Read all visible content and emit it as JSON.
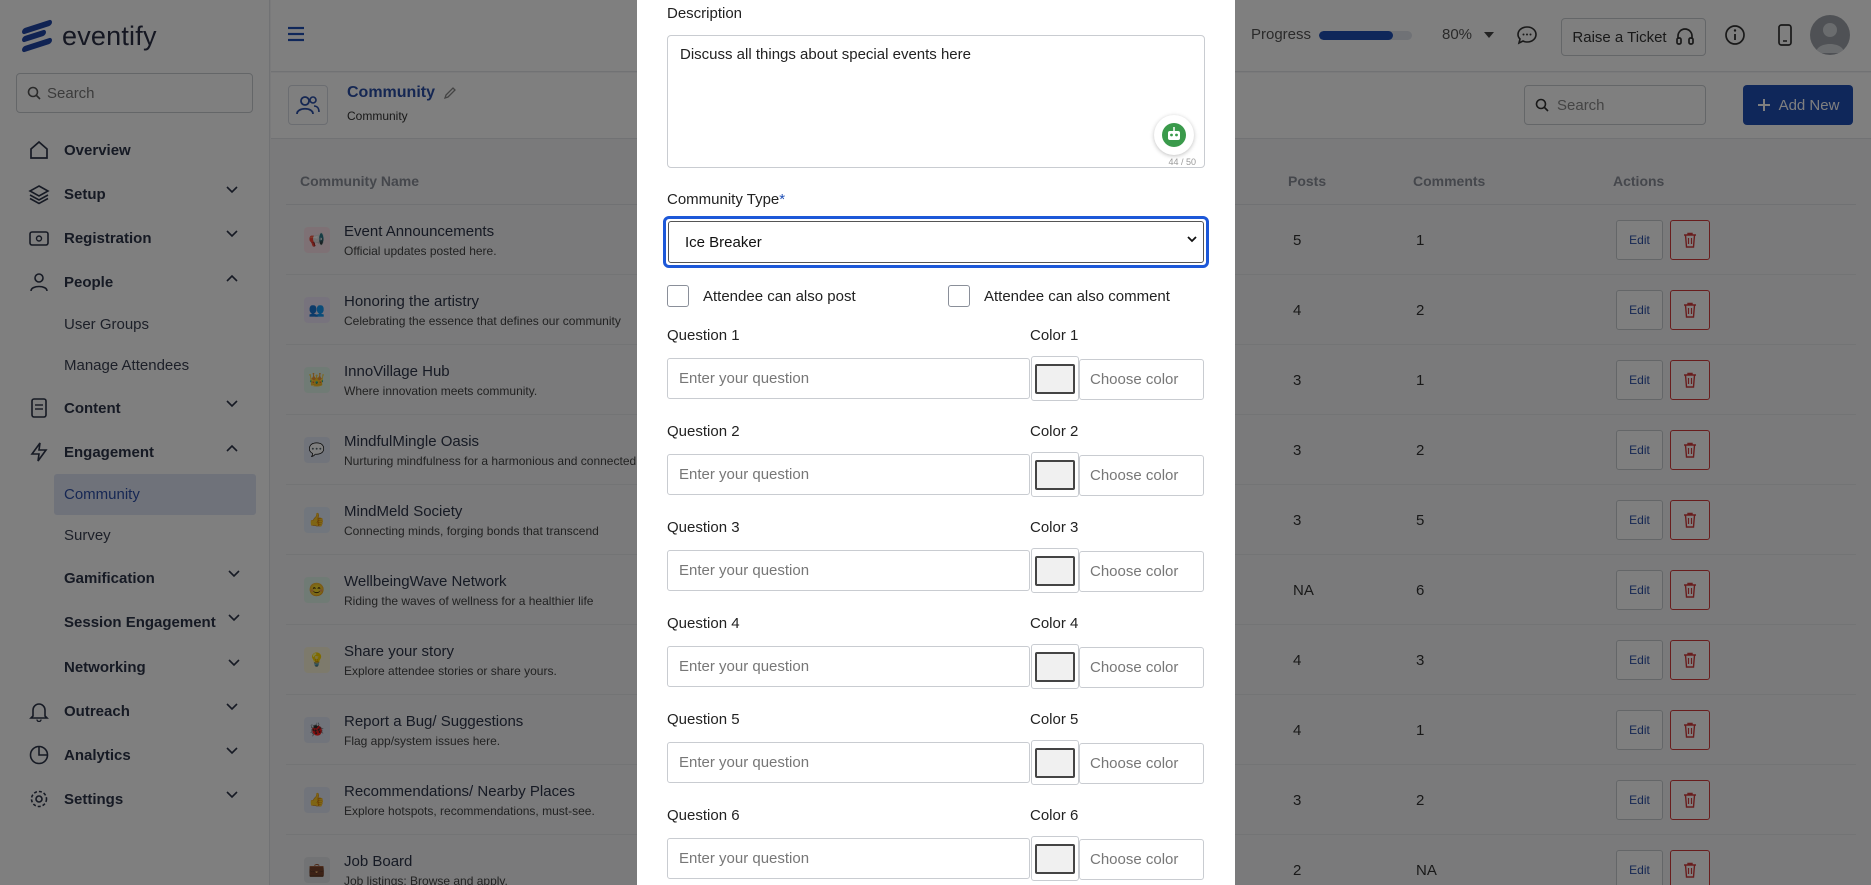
{
  "app": {
    "name": "eventify"
  },
  "sidebar": {
    "search_placeholder": "Search",
    "items": [
      {
        "label": "Overview"
      },
      {
        "label": "Setup"
      },
      {
        "label": "Registration"
      },
      {
        "label": "People"
      },
      {
        "label": "User Groups"
      },
      {
        "label": "Manage Attendees"
      },
      {
        "label": "Content"
      },
      {
        "label": "Engagement"
      },
      {
        "label": "Community"
      },
      {
        "label": "Survey"
      },
      {
        "label": "Gamification"
      },
      {
        "label": "Session Engagement"
      },
      {
        "label": "Networking"
      },
      {
        "label": "Outreach"
      },
      {
        "label": "Analytics"
      },
      {
        "label": "Settings"
      }
    ]
  },
  "topbar": {
    "progress_label": "Progress",
    "progress_value": 0.8,
    "progress_pct": "80%",
    "ticket_label": "Raise a Ticket"
  },
  "page": {
    "title": "Community",
    "subtitle": "Community",
    "search_placeholder": "Search",
    "add_label": "Add New"
  },
  "table": {
    "headers": {
      "name": "Community Name",
      "posts": "Posts",
      "comments": "Comments",
      "actions": "Actions"
    },
    "edit_label": "Edit",
    "rows": [
      {
        "name": "Event Announcements",
        "desc": "Official updates posted here.",
        "posts": "5",
        "comments": "1",
        "icon_color": "#e0245e",
        "icon_bg": "#fde3ea",
        "icon": "📢"
      },
      {
        "name": "Honoring the artistry",
        "desc": "Celebrating the essence that defines our community",
        "posts": "4",
        "comments": "2",
        "icon_color": "#8a4fd3",
        "icon_bg": "#efe6fb",
        "icon": "👥"
      },
      {
        "name": "InnoVillage Hub",
        "desc": "Where innovation meets community.",
        "posts": "3",
        "comments": "1",
        "icon_color": "#18a058",
        "icon_bg": "#e1f6ea",
        "icon": "👑"
      },
      {
        "name": "MindfulMingle Oasis",
        "desc": "Nurturing mindfulness for a harmonious and connected",
        "posts": "3",
        "comments": "2",
        "icon_color": "#2a4ea6",
        "icon_bg": "#e2e8f7",
        "icon": "💬"
      },
      {
        "name": "MindMeld Society",
        "desc": "Connecting minds, forging bonds that transcend",
        "posts": "3",
        "comments": "5",
        "icon_color": "#2a6fd6",
        "icon_bg": "#e2ecfb",
        "icon": "👍"
      },
      {
        "name": "WellbeingWave Network",
        "desc": "Riding the waves of wellness for a healthier life",
        "posts": "NA",
        "comments": "6",
        "icon_color": "#18a058",
        "icon_bg": "#e1f6ea",
        "icon": "😊"
      },
      {
        "name": "Share your story",
        "desc": "Explore attendee stories or share yours.",
        "posts": "4",
        "comments": "3",
        "icon_color": "#d6b21a",
        "icon_bg": "#fbf5d9",
        "icon": "💡"
      },
      {
        "name": "Report a Bug/ Suggestions",
        "desc": "Flag app/system issues here.",
        "posts": "4",
        "comments": "1",
        "icon_color": "#2a4ea6",
        "icon_bg": "#e2e8f7",
        "icon": "🐞"
      },
      {
        "name": "Recommendations/ Nearby Places",
        "desc": "Explore hotspots, recommendations, must-see.",
        "posts": "3",
        "comments": "2",
        "icon_color": "#2a4ea6",
        "icon_bg": "#e2e8f7",
        "icon": "👍"
      },
      {
        "name": "Job Board",
        "desc": "Job listings: Browse and apply.",
        "posts": "2",
        "comments": "NA",
        "icon_color": "#2d3448",
        "icon_bg": "#e4e6ea",
        "icon": "💼"
      }
    ]
  },
  "modal": {
    "description_label": "Description",
    "description_value": "Discuss all things about special events here",
    "counter": "44 / 50",
    "type_label": "Community Type",
    "type_value": "Ice Breaker",
    "post_checkbox_label": "Attendee can also post",
    "comment_checkbox_label": "Attendee can also comment",
    "question_placeholder": "Enter your question",
    "color_placeholder": "Choose color",
    "questions": [
      {
        "q_label": "Question 1",
        "c_label": "Color 1"
      },
      {
        "q_label": "Question 2",
        "c_label": "Color 2"
      },
      {
        "q_label": "Question 3",
        "c_label": "Color 3"
      },
      {
        "q_label": "Question 4",
        "c_label": "Color 4"
      },
      {
        "q_label": "Question 5",
        "c_label": "Color 5"
      },
      {
        "q_label": "Question 6",
        "c_label": "Color 6"
      }
    ]
  },
  "colors": {
    "brand": "#1f4fb5",
    "focus": "#1d58d8",
    "danger": "#d33a3a",
    "active_bg": "#dfe5f5"
  }
}
